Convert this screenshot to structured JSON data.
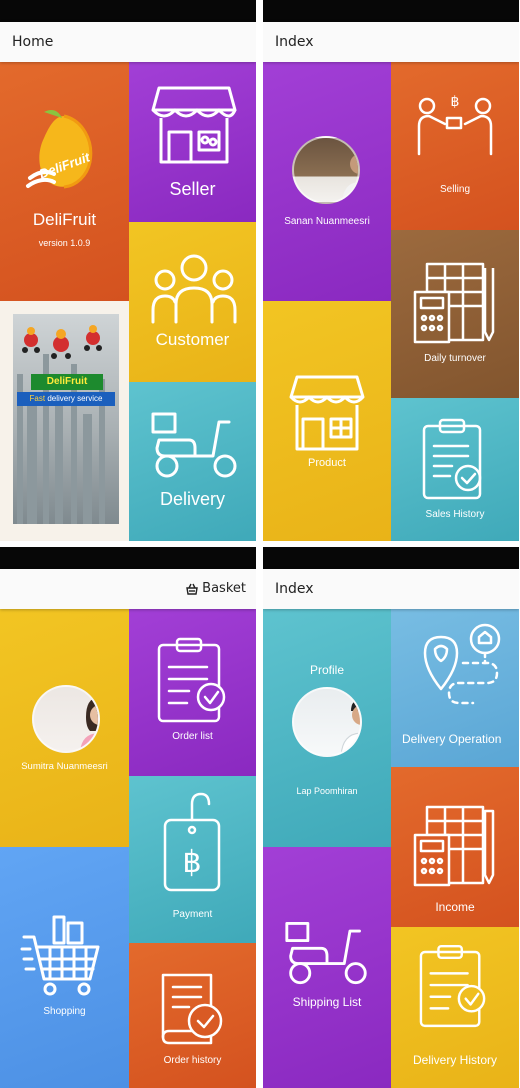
{
  "screens": {
    "home": {
      "title": "Home",
      "app_name": "DeliFruit",
      "logo_text": "DeliFruit",
      "version": "version 1.0.9",
      "seller_label": "Seller",
      "customer_label": "Customer",
      "delivery_label": "Delivery",
      "banner_logo": "DeliFruit",
      "banner_tag_a": "Fast",
      "banner_tag_b": " delivery service"
    },
    "seller_index": {
      "title": "Index",
      "user_name": "Sanan Nuanmeesri",
      "selling_label": "Selling",
      "daily_turnover_label": "Daily turnover",
      "product_label": "Product",
      "sales_history_label": "Sales History"
    },
    "customer_index": {
      "basket_label": "Basket",
      "user_name": "Sumitra Nuanmeesri",
      "order_list_label": "Order list",
      "payment_label": "Payment",
      "shopping_label": "Shopping",
      "order_history_label": "Order history"
    },
    "delivery_index": {
      "title": "Index",
      "profile_label": "Profile",
      "user_name": "Lap Poomhiran",
      "delivery_operation_label": "Delivery Operation",
      "income_label": "Income",
      "shipping_list_label": "Shipping List",
      "delivery_history_label": "Delivery History"
    }
  },
  "colors": {
    "orange": "#d95a24",
    "purple": "#9535cc",
    "yellow": "#efbe1f",
    "teal": "#4fb6c4",
    "brown": "#8e5f35",
    "blue": "#5a9cee",
    "sky_blue": "#6ab2dd"
  }
}
